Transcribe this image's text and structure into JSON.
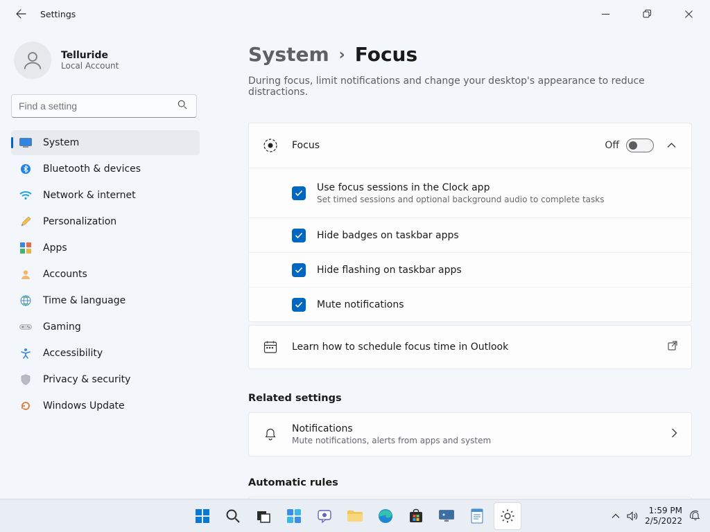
{
  "titlebar": {
    "title": "Settings"
  },
  "account": {
    "name": "Telluride",
    "type": "Local Account"
  },
  "search": {
    "placeholder": "Find a setting"
  },
  "sidebar": {
    "items": [
      {
        "label": "System"
      },
      {
        "label": "Bluetooth & devices"
      },
      {
        "label": "Network & internet"
      },
      {
        "label": "Personalization"
      },
      {
        "label": "Apps"
      },
      {
        "label": "Accounts"
      },
      {
        "label": "Time & language"
      },
      {
        "label": "Gaming"
      },
      {
        "label": "Accessibility"
      },
      {
        "label": "Privacy & security"
      },
      {
        "label": "Windows Update"
      }
    ]
  },
  "breadcrumb": {
    "parent": "System",
    "current": "Focus"
  },
  "description": "During focus, limit notifications and change your desktop's appearance to reduce distractions.",
  "focus": {
    "label": "Focus",
    "state": "Off",
    "options": [
      {
        "title": "Use focus sessions in the Clock app",
        "sub": "Set timed sessions and optional background audio to complete tasks",
        "checked": true
      },
      {
        "title": "Hide badges on taskbar apps",
        "checked": true
      },
      {
        "title": "Hide flashing on taskbar apps",
        "checked": true
      },
      {
        "title": "Mute notifications",
        "checked": true
      }
    ],
    "learn": "Learn how to schedule focus time in Outlook"
  },
  "related": {
    "heading": "Related settings",
    "notifications": {
      "title": "Notifications",
      "sub": "Mute notifications, alerts from apps and system"
    }
  },
  "automatic": {
    "heading": "Automatic rules"
  },
  "taskbar": {
    "time": "1:59 PM",
    "date": "2/5/2022"
  }
}
